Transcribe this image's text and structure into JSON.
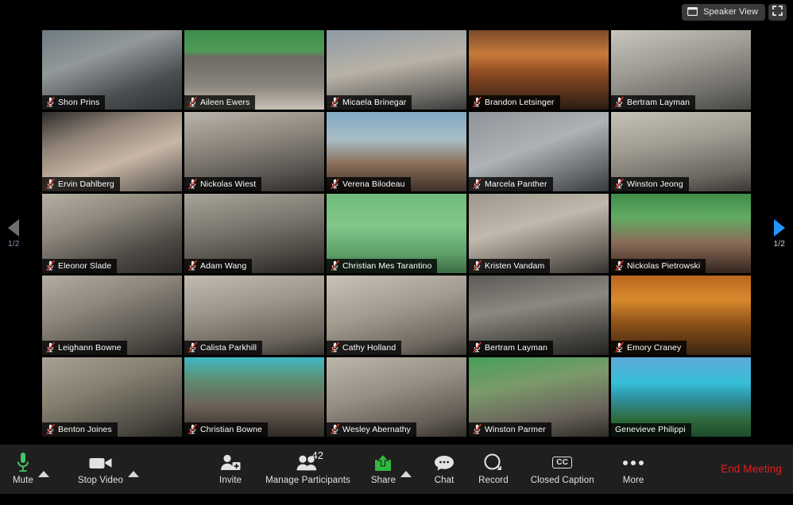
{
  "window": {
    "background_color": "#000000",
    "toolbar_color": "#1f1f1f"
  },
  "header": {
    "view_toggle_label": "Speaker View",
    "view_toggle_icon": "speaker-view-icon",
    "fullscreen_icon": "fullscreen-icon"
  },
  "pager": {
    "left_label": "1/2",
    "right_label": "1/2",
    "left_icon": "chevron-left-icon",
    "right_icon": "chevron-right-icon",
    "left_enabled_color": "#6e6e6e",
    "right_enabled_color": "#2196ff"
  },
  "gallery": {
    "columns": 5,
    "rows": 5,
    "active_border_color": "#d7e86a",
    "muted_icon": "microphone-muted-icon",
    "participants": [
      {
        "name": "Shon Prins",
        "muted": true,
        "active": false,
        "bg": "linear-gradient(160deg,#6d7a80 0%,#93999a 35%,#4b4f52 70%,#2e3133 100%)"
      },
      {
        "name": "Aileen Ewers",
        "muted": true,
        "active": false,
        "bg": "linear-gradient(180deg,#3f8c4a 0%,#4f9a57 26%,#6e6a63 34%,#8a857c 70%,#c8c2b6 100%)"
      },
      {
        "name": "Micaela Brinegar",
        "muted": true,
        "active": false,
        "bg": "linear-gradient(170deg,#8d9aa6 0%,#b9b2a6 45%,#6c6a66 80%,#3b3a38 100%)"
      },
      {
        "name": "Brandon Letsinger",
        "muted": true,
        "active": false,
        "bg": "linear-gradient(180deg,#7a4a2a 0%,#c97a3a 30%,#8a4a22 55%,#2b1c14 100%)"
      },
      {
        "name": "Bertram Layman",
        "muted": true,
        "active": false,
        "bg": "linear-gradient(165deg,#c9c6bd 0%,#9f9c95 40%,#6f6d68 75%,#46443f 100%)"
      },
      {
        "name": "Ervin Dahlberg",
        "muted": true,
        "active": false,
        "bg": "linear-gradient(160deg,#2d2b2a 0%,#8f8276 30%,#c8b7a6 60%,#55504c 100%)"
      },
      {
        "name": "Nickolas Wiest",
        "muted": true,
        "active": false,
        "bg": "linear-gradient(170deg,#b9b4ab 0%,#8b857c 40%,#585450 75%,#2e2c2a 100%)"
      },
      {
        "name": "Verena Bilodeau",
        "muted": true,
        "active": false,
        "bg": "linear-gradient(180deg,#7fa9c4 0%,#a9bdc6 35%,#8b6f5a 65%,#3d3028 100%)"
      },
      {
        "name": "Marcela Panther",
        "muted": true,
        "active": false,
        "bg": "linear-gradient(160deg,#8e949a 0%,#aeb2b5 45%,#63666a 80%,#37393c 100%)"
      },
      {
        "name": "Winston Jeong",
        "muted": true,
        "active": false,
        "bg": "linear-gradient(170deg,#c6c2b8 0%,#a19c92 40%,#6a6660 78%,#3a3834 100%)"
      },
      {
        "name": "Eleonor Slade",
        "muted": true,
        "active": false,
        "bg": "linear-gradient(160deg,#b6b0a4 0%,#8d877c 35%,#4f4b46 70%,#2a2826 100%)"
      },
      {
        "name": "Adam Wang",
        "muted": true,
        "active": false,
        "bg": "linear-gradient(170deg,#a9a49a 0%,#7d786f 40%,#4c4843 75%,#26241f 100%)"
      },
      {
        "name": "Christian Mes Tarantino",
        "muted": true,
        "active": false,
        "bg": "linear-gradient(180deg,#6fbb7a 0%,#82c78a 40%,#5fa06a 75%,#3c6b44 100%)"
      },
      {
        "name": "Kristen Vandam",
        "muted": true,
        "active": false,
        "bg": "linear-gradient(165deg,#9c968c 0%,#c0b9ad 40%,#6b655d 78%,#33312e 100%)"
      },
      {
        "name": "Nickolas Pietrowski",
        "muted": true,
        "active": false,
        "bg": "linear-gradient(180deg,#3f8c4a 0%,#63ab63 30%,#8a6a58 62%,#33251e 100%)"
      },
      {
        "name": "Leighann Bowne",
        "muted": true,
        "active": false,
        "bg": "linear-gradient(160deg,#b3ada1 0%,#8b857a 38%,#55514b 75%,#2c2a27 100%)"
      },
      {
        "name": "Calista Parkhill",
        "muted": true,
        "active": false,
        "bg": "linear-gradient(170deg,#c2bcb0 0%,#9b958a 40%,#6a645c 78%,#35332f 100%)"
      },
      {
        "name": "Cathy Holland",
        "muted": true,
        "active": false,
        "bg": "linear-gradient(165deg,#c9c3b7 0%,#a39d91 42%,#6e6860 80%,#3a3834 100%)"
      },
      {
        "name": "Bertram Layman",
        "muted": true,
        "active": false,
        "bg": "linear-gradient(170deg,#5c5a57 0%,#8b8880 40%,#46443f 78%,#242320 100%)"
      },
      {
        "name": "Emory Craney",
        "muted": true,
        "active": false,
        "bg": "linear-gradient(180deg,#b8671f 0%,#d98a2c 30%,#8a4f18 62%,#3a2510 100%)"
      },
      {
        "name": "Benton Joines",
        "muted": true,
        "active": false,
        "bg": "linear-gradient(160deg,#a8a296 0%,#85806f 38%,#524e47 76%,#2a2825 100%)"
      },
      {
        "name": "Christian Bowne",
        "muted": true,
        "active": false,
        "bg": "linear-gradient(180deg,#3fb8c4 0%,#5d8f72 28%,#6e6258 60%,#2e2a26 100%)"
      },
      {
        "name": "Wesley Abernathy",
        "muted": true,
        "active": false,
        "bg": "linear-gradient(165deg,#bdb7ab 0%,#958f84 42%,#635d55 78%,#332f2b 100%)"
      },
      {
        "name": "Winston Parmer",
        "muted": true,
        "active": false,
        "bg": "linear-gradient(170deg,#46a05a 0%,#7a9a6a 35%,#6b655c 70%,#2f2c28 100%)"
      },
      {
        "name": "Genevieve Philippi",
        "muted": false,
        "active": true,
        "bg": "linear-gradient(180deg,#5fa8d8 0%,#36c0d8 32%,#2e8fa0 52%,#2f6b3e 78%,#1f4a2c 100%)"
      }
    ]
  },
  "toolbar": {
    "items": [
      {
        "id": "mute",
        "label": "Mute",
        "icon": "microphone-icon",
        "has_caret": true,
        "badge": null
      },
      {
        "id": "stop-video",
        "label": "Stop Video",
        "icon": "video-camera-icon",
        "has_caret": true,
        "badge": null
      },
      {
        "id": "invite",
        "label": "Invite",
        "icon": "invite-person-icon",
        "has_caret": false,
        "badge": null
      },
      {
        "id": "manage-participants",
        "label": "Manage Participants",
        "icon": "participants-icon",
        "has_caret": false,
        "badge": "42"
      },
      {
        "id": "share",
        "label": "Share",
        "icon": "share-screen-icon",
        "has_caret": true,
        "badge": null
      },
      {
        "id": "chat",
        "label": "Chat",
        "icon": "chat-bubble-icon",
        "has_caret": false,
        "badge": null
      },
      {
        "id": "record",
        "label": "Record",
        "icon": "record-icon",
        "has_caret": false,
        "badge": null
      },
      {
        "id": "closed-caption",
        "label": "Closed Caption",
        "icon": "closed-caption-icon",
        "has_caret": false,
        "badge": null
      },
      {
        "id": "more",
        "label": "More",
        "icon": "ellipsis-icon",
        "has_caret": false,
        "badge": null
      }
    ],
    "end_meeting_label": "End Meeting",
    "end_meeting_color": "#e02020",
    "mic_active_color": "#44c767",
    "share_color": "#30b83c"
  }
}
